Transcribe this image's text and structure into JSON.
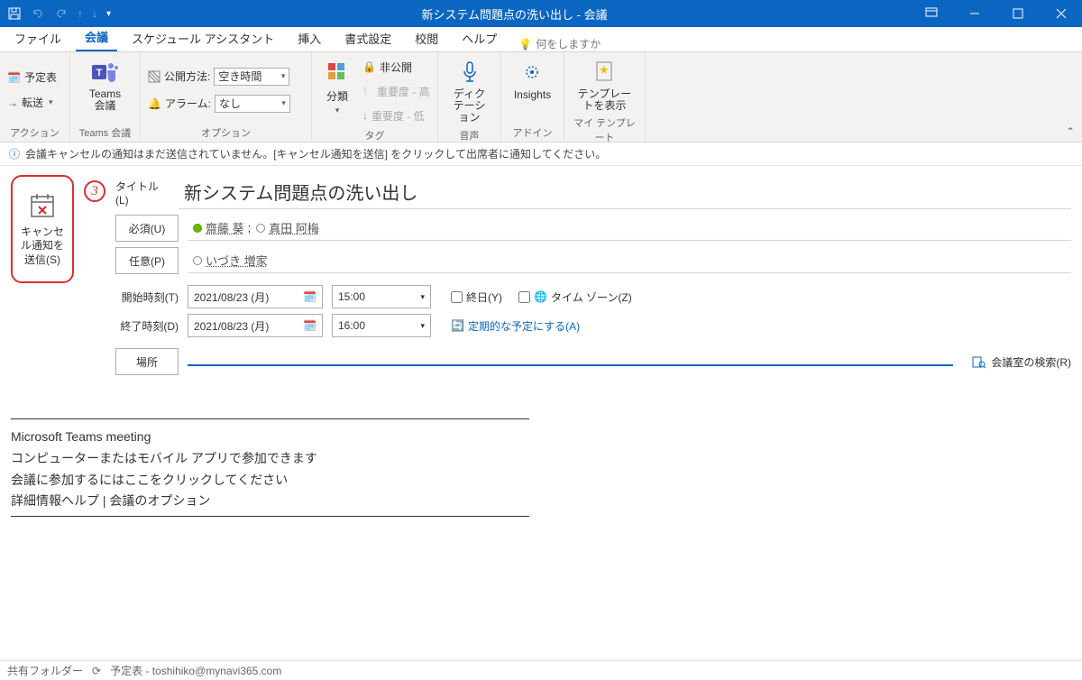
{
  "window": {
    "title": "新システム問題点の洗い出し - 会議"
  },
  "tabs": {
    "file": "ファイル",
    "meeting": "会議",
    "sched": "スケジュール アシスタント",
    "insert": "挿入",
    "format": "書式設定",
    "review": "校閲",
    "help": "ヘルプ",
    "tellme": "何をしますか"
  },
  "ribbon": {
    "action": {
      "schedule": "予定表",
      "forward": "転送",
      "label": "アクション"
    },
    "teams": {
      "btn": "Teams\n会議",
      "label": "Teams 会議"
    },
    "options": {
      "showas_lbl": "公開方法:",
      "showas_val": "空き時間",
      "reminder_lbl": "アラーム:",
      "reminder_val": "なし",
      "label": "オプション"
    },
    "tags": {
      "categorize": "分類",
      "private": "非公開",
      "high": "重要度 - 高",
      "low": "重要度 - 低",
      "label": "タグ"
    },
    "voice": {
      "dictate": "ディク\nテーション",
      "label": "音声"
    },
    "addin": {
      "insights": "Insights",
      "label": "アドイン"
    },
    "templates": {
      "btn": "テンプレー\nトを表示",
      "label": "マイ テンプレート"
    }
  },
  "infobar": "会議キャンセルの通知はまだ送信されていません。[キャンセル通知を送信] をクリックして出席者に通知してください。",
  "annotation": "3",
  "cancelSend": "キャンセル通知を送信(S)",
  "form": {
    "title_lbl": "タイトル(L)",
    "title_val": "新システム問題点の洗い出し",
    "req_btn": "必須(U)",
    "req_att": [
      {
        "name": "齋藤 葵",
        "status": "available"
      },
      {
        "name": "真田 阿梅",
        "status": "unknown"
      }
    ],
    "opt_btn": "任意(P)",
    "opt_att": [
      {
        "name": "いづき 増家",
        "status": "unknown"
      }
    ],
    "start_lbl": "開始時刻(T)",
    "start_date": "2021/08/23 (月)",
    "start_time": "15:00",
    "end_lbl": "終了時刻(D)",
    "end_date": "2021/08/23 (月)",
    "end_time": "16:00",
    "allday": "終日(Y)",
    "tz": "タイム ゾーン(Z)",
    "recur": "定期的な予定にする(A)",
    "loc_btn": "場所",
    "findroom": "会議室の検索(R)"
  },
  "body": {
    "line1": "Microsoft Teams meeting",
    "line2": "コンピューターまたはモバイル アプリで参加できます",
    "line3": "会議に参加するにはここをクリックしてください",
    "line4a": "詳細情報ヘルプ",
    "line4sep": " | ",
    "line4b": "会議のオプション"
  },
  "statusbar": {
    "shared": "共有フォルダー",
    "calendar": "予定表 - toshihiko@mynavi365.com"
  }
}
